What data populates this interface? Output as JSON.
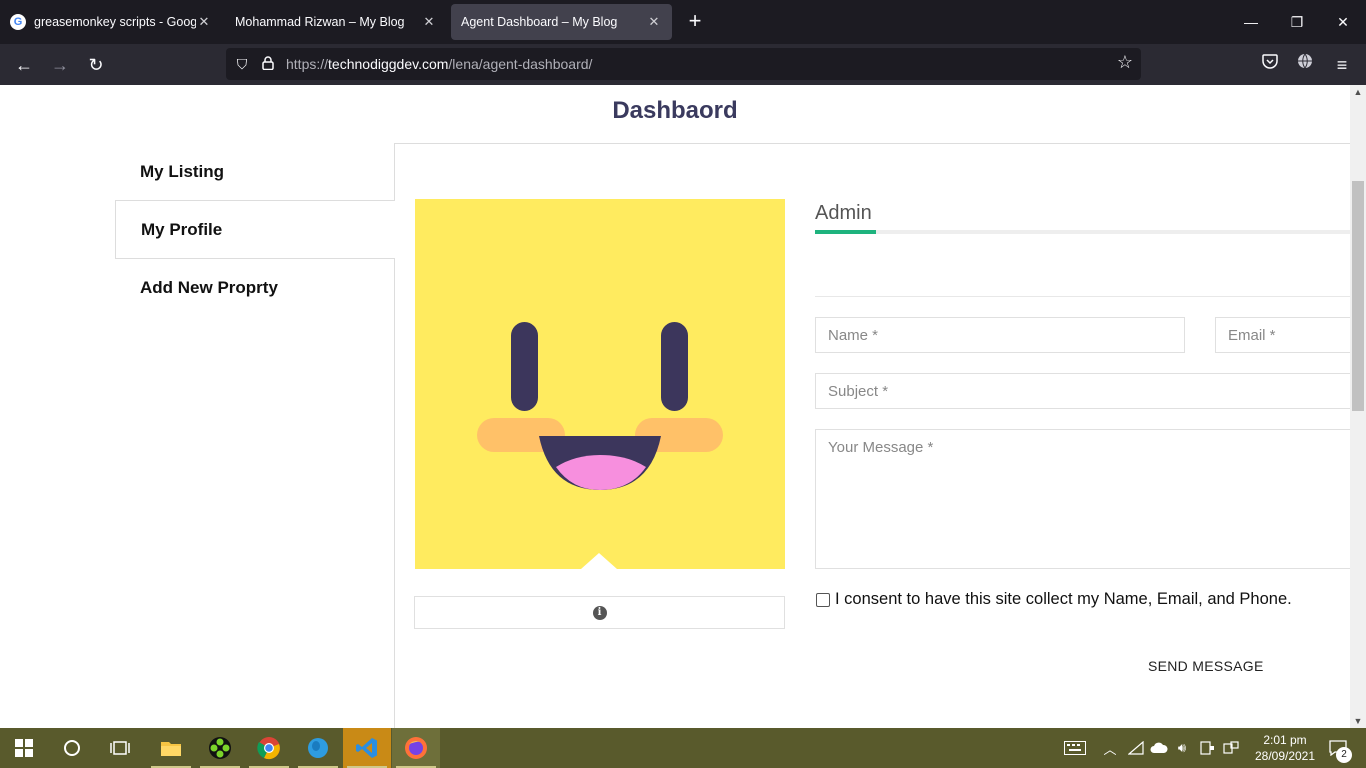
{
  "browser": {
    "tabs": [
      {
        "title": "greasemonkey scripts - Google"
      },
      {
        "title": "Mohammad Rizwan – My Blog"
      },
      {
        "title": "Agent Dashboard – My Blog"
      }
    ],
    "url_prefix": "https://",
    "url_domain": "technodiggdev.com",
    "url_path": "/lena/agent-dashboard/"
  },
  "page": {
    "title": "Dashbaord",
    "sidebar": [
      {
        "label": "My Listing"
      },
      {
        "label": "My Profile"
      },
      {
        "label": "Add New Proprty"
      }
    ],
    "profile": {
      "name": "Admin",
      "avatar_colors": {
        "background": "#ffeb5f",
        "eyes": "#3c365c",
        "cheeks": "#ffc168",
        "mouth": "#3c365c",
        "tongue": "#f78fde"
      }
    },
    "form": {
      "name_placeholder": "Name *",
      "email_placeholder": "Email *",
      "subject_placeholder": "Subject *",
      "message_placeholder": "Your Message *",
      "consent_label": "I consent to have this site collect my Name, Email, and Phone.",
      "send_label": "SEND MESSAGE"
    },
    "accent_color": "#1eb37e"
  },
  "taskbar": {
    "time": "2:01 pm",
    "date": "28/09/2021",
    "notification_count": "2"
  }
}
